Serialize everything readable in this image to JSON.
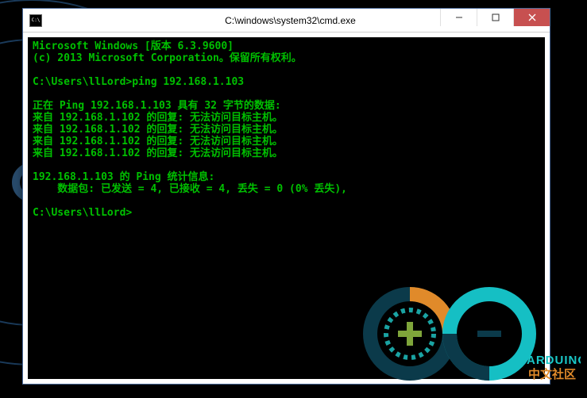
{
  "window": {
    "title": "C:\\windows\\system32\\cmd.exe"
  },
  "terminal": {
    "lines": [
      "Microsoft Windows [版本 6.3.9600]",
      "(c) 2013 Microsoft Corporation。保留所有权利。",
      "",
      "C:\\Users\\llLord>ping 192.168.1.103",
      "",
      "正在 Ping 192.168.1.103 具有 32 字节的数据:",
      "来自 192.168.1.102 的回复: 无法访问目标主机。",
      "来自 192.168.1.102 的回复: 无法访问目标主机。",
      "来自 192.168.1.102 的回复: 无法访问目标主机。",
      "来自 192.168.1.102 的回复: 无法访问目标主机。",
      "",
      "192.168.1.103 的 Ping 统计信息:",
      "    数据包: 已发送 = 4, 已接收 = 4, 丢失 = 0 (0% 丢失),",
      "",
      "C:\\Users\\llLord>"
    ]
  },
  "watermark": {
    "brand": "ARDUINO",
    "subtitle": "中文社区"
  }
}
